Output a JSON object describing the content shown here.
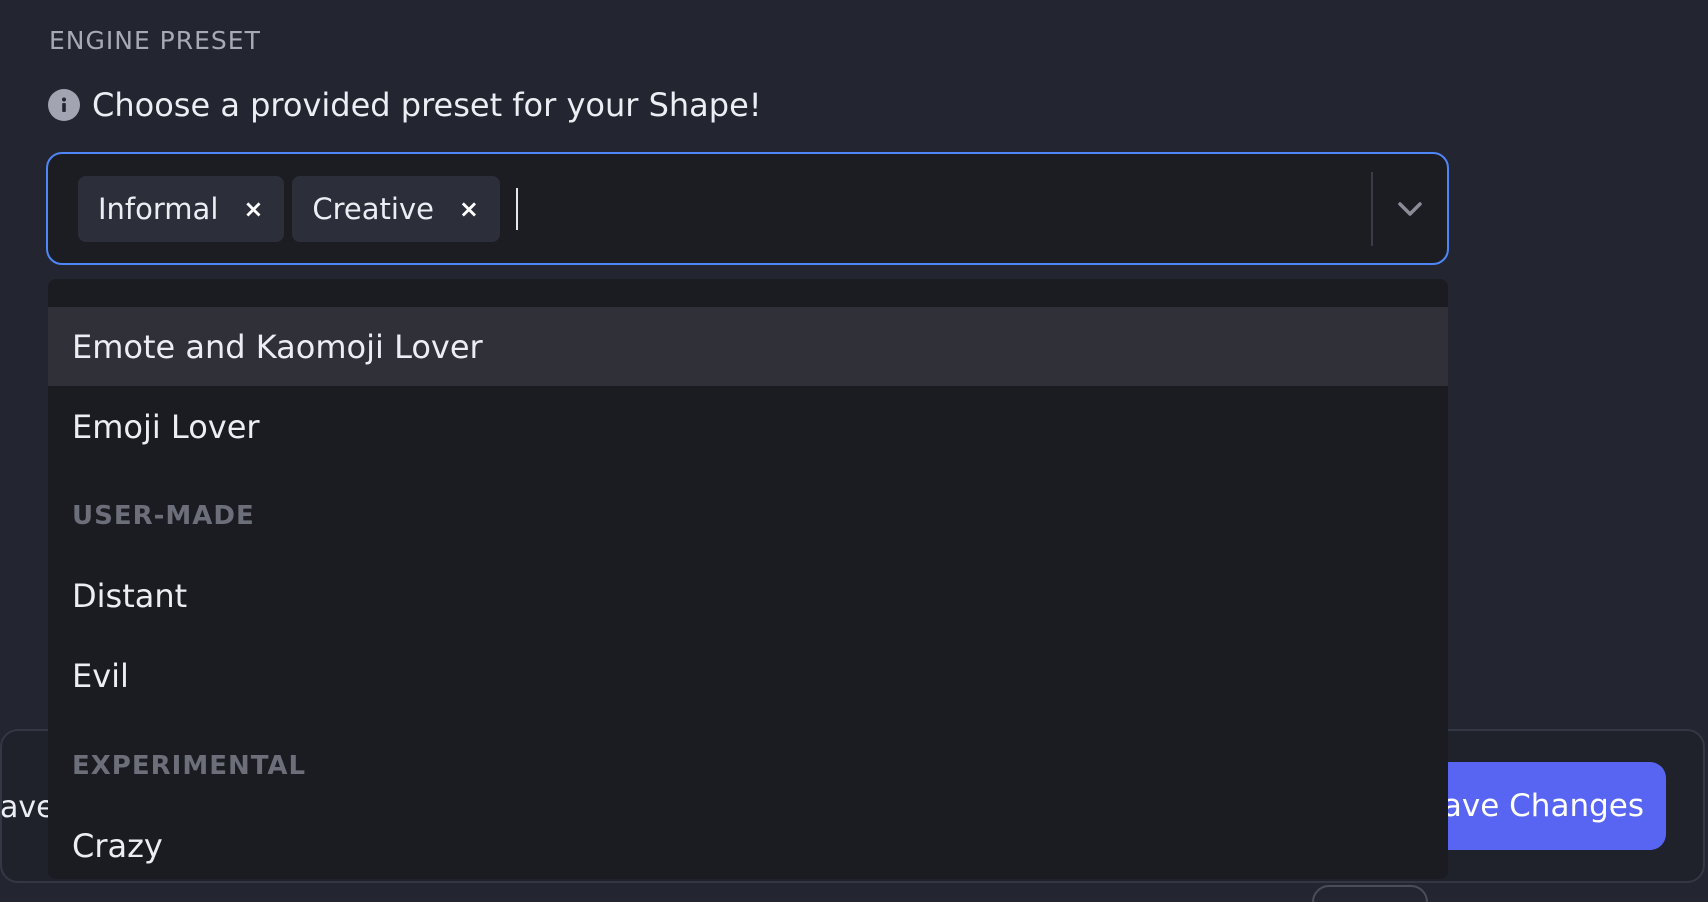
{
  "section": {
    "title": "ENGINE PRESET",
    "hint": "Choose a provided preset for your Shape!",
    "hint_icon": "info-icon"
  },
  "select": {
    "chips": [
      {
        "label": "Informal"
      },
      {
        "label": "Creative"
      }
    ],
    "remove_glyph": "×",
    "focus_color": "#4f86f7"
  },
  "menu": {
    "cutoff_text": "",
    "options_top": [
      {
        "label": "Emote and Kaomoji Lover",
        "focused": true
      },
      {
        "label": "Emoji Lover",
        "focused": false
      }
    ],
    "groups": [
      {
        "label": "USER-MADE",
        "options": [
          {
            "label": "Distant"
          },
          {
            "label": "Evil"
          }
        ]
      },
      {
        "label": "EXPERIMENTAL",
        "options": [
          {
            "label": "Crazy"
          }
        ]
      }
    ]
  },
  "footer": {
    "left_button_label": "ave",
    "save_label": "ave Changes",
    "accent_color": "#5865f2"
  }
}
